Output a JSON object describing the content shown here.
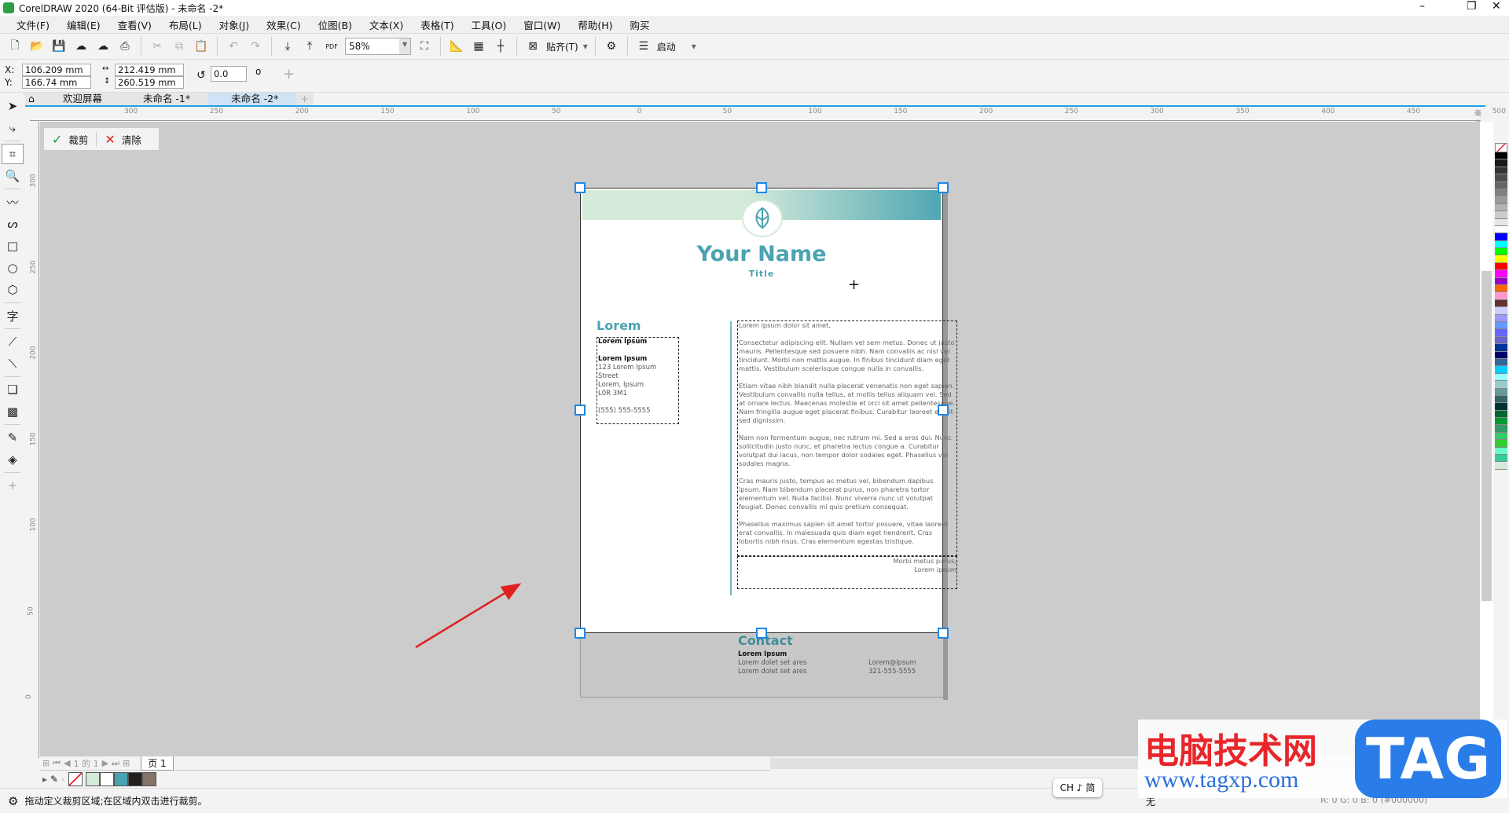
{
  "app": {
    "title": "CorelDRAW 2020 (64-Bit 评估版) - 未命名 -2*"
  },
  "menu": [
    "文件(F)",
    "编辑(E)",
    "查看(V)",
    "布局(L)",
    "对象(J)",
    "效果(C)",
    "位图(B)",
    "文本(X)",
    "表格(T)",
    "工具(O)",
    "窗口(W)",
    "帮助(H)",
    "购买"
  ],
  "toolbar": {
    "zoom": "58%",
    "snap": "贴齐(T)",
    "launch": "启动",
    "pdf": "PDF"
  },
  "props": {
    "x_label": "X:",
    "y_label": "Y:",
    "x": "106.209 mm",
    "y": "166.74 mm",
    "width": "212.419 mm",
    "height": "260.519 mm",
    "rotation": "0.0",
    "degree": "o"
  },
  "tabs": [
    {
      "label": "欢迎屏幕"
    },
    {
      "label": "未命名 -1*"
    },
    {
      "label": "未命名 -2*",
      "active": true
    }
  ],
  "ruler": {
    "unit": "毫米",
    "top": [
      "300",
      "250",
      "200",
      "150",
      "100",
      "50",
      "0",
      "50",
      "100",
      "150",
      "200",
      "250",
      "300",
      "350",
      "400",
      "450",
      "500"
    ],
    "left": [
      "300",
      "250",
      "200",
      "150",
      "100",
      "50",
      "0"
    ]
  },
  "crop": {
    "apply": "裁剪",
    "clear": "清除"
  },
  "doc": {
    "name": "Your Name",
    "title": "Title",
    "section": "Lorem",
    "left": {
      "h1": "Lorem Ipsum",
      "h2": "Lorem Ipsum",
      "addr1": "123 Lorem Ipsum Street",
      "addr2": "Lorem, Ipsum",
      "addr3": "L0R 3M1",
      "phone": "(555) 555-5555"
    },
    "body": [
      "Lorem ipsum dolor sit amet,",
      "Consectetur adipiscing elit. Nullam vel sem metus. Donec ut justo mauris. Pellentesque sed posuere nibh. Nam convallis ac nisl vel tincidunt. Morbi non mattis augue. In finibus tincidunt diam eget mattis. Vestibulum scelerisque congue nulla in convallis.",
      "Etiam vitae nibh blandit nulla placerat venenatis non eget sapien. Vestibulum convallis nulla tellus, at mollis tellus aliquam vel. Sed at ornare lectus. Maecenas molestie et orci sit amet pellentesque. Nam fringilla augue eget placerat finibus. Curabitur laoreet et elit sed dignissim.",
      "Nam non fermentum augue, nec rutrum mi. Sed a eros dui. Nunc sollicitudin justo nunc, et pharetra lectus congue a. Curabitur volutpat dui lacus, non tempor dolor sodales eget. Phasellus vel sodales magna.",
      "Cras mauris justo, tempus ac metus vel, bibendum dapibus ipsum. Nam bibendum placerat purus, non pharetra tortor elementum vel. Nulla facilisi. Nunc viverra nunc ut volutpat feugiat. Donec convallis mi quis pretium consequat.",
      "Phasellus maximus sapien sit amet tortor posuere, vitae laoreet erat convallis. In malesuada quis diam eget hendrerit. Cras lobortis nibh risus. Cras elementum egestas tristique."
    ],
    "closing1": "Morbi metus purus,",
    "closing2": "Lorem ipsum",
    "contact": {
      "heading": "Contact",
      "name": "Lorem Ipsum",
      "line1": "Lorem dolet set ares",
      "line2": "Lorem dolet set ares",
      "email": "Lorem@ipsum",
      "phone": "321-555-5555"
    }
  },
  "pagenav": {
    "counter": "1 的 1",
    "page_tab": "页 1"
  },
  "status": {
    "hint": "拖动定义裁剪区域;在区域内双击进行裁剪。",
    "ime": "CH ♪ 简",
    "fill": "无",
    "color_info": "R: 0 G: 0 B: 0 (#000000)"
  },
  "watermark": {
    "text": "电脑技术网",
    "url": "www.tagxp.com",
    "badge": "TAG"
  },
  "colors": {
    "accent": "#4aa3b0",
    "canvas": "#cccccc",
    "handle": "#1e88e5",
    "arrow": "#e02020"
  },
  "doc_palette": [
    "#d5ebd9",
    "#ffffff",
    "#4aa3b0",
    "#231f1c",
    "#85736a"
  ],
  "palette": [
    "#000000",
    "#1a1a1a",
    "#333333",
    "#4d4d4d",
    "#666666",
    "#808080",
    "#999999",
    "#b3b3b3",
    "#cccccc",
    "#e6e6e6",
    "#ffffff",
    "#0000ff",
    "#00ffff",
    "#00ff00",
    "#ffff00",
    "#ff0000",
    "#ff00ff",
    "#9900cc",
    "#ff6600",
    "#ff99cc",
    "#663333",
    "#ccccff",
    "#9999ff",
    "#6699ff",
    "#6666ff",
    "#6666cc",
    "#003399",
    "#000066",
    "#336699",
    "#00ccff",
    "#99ffff",
    "#99cccc",
    "#669999",
    "#336666",
    "#003333",
    "#006633",
    "#009933",
    "#339966",
    "#33cc66",
    "#33cc33",
    "#66ffcc",
    "#33cc99",
    "#d5ebd9"
  ]
}
